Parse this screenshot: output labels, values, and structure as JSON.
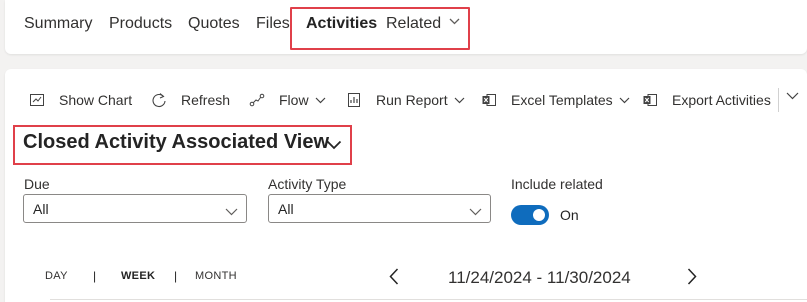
{
  "tabs": {
    "items": [
      {
        "label": "Summary"
      },
      {
        "label": "Products"
      },
      {
        "label": "Quotes"
      },
      {
        "label": "Files"
      },
      {
        "label": "Activities",
        "selected": true
      },
      {
        "label": "Related",
        "has_dropdown": true
      }
    ]
  },
  "commands": {
    "show_chart": "Show Chart",
    "refresh": "Refresh",
    "flow": "Flow",
    "run_report": "Run Report",
    "excel_templates": "Excel Templates",
    "export_activities": "Export Activities"
  },
  "view": {
    "title": "Closed Activity Associated View"
  },
  "filters": {
    "due": {
      "label": "Due",
      "value": "All"
    },
    "activity_type": {
      "label": "Activity Type",
      "value": "All"
    },
    "include_related": {
      "label": "Include related",
      "state": "On",
      "enabled": true
    }
  },
  "calendar": {
    "day": "DAY",
    "week": "WEEK",
    "month": "MONTH",
    "separator": "|",
    "selected": "WEEK",
    "date_range": "11/24/2024 - 11/30/2024"
  },
  "colors": {
    "highlight": "#e0404a",
    "toggle_on": "#0f6cbd"
  }
}
